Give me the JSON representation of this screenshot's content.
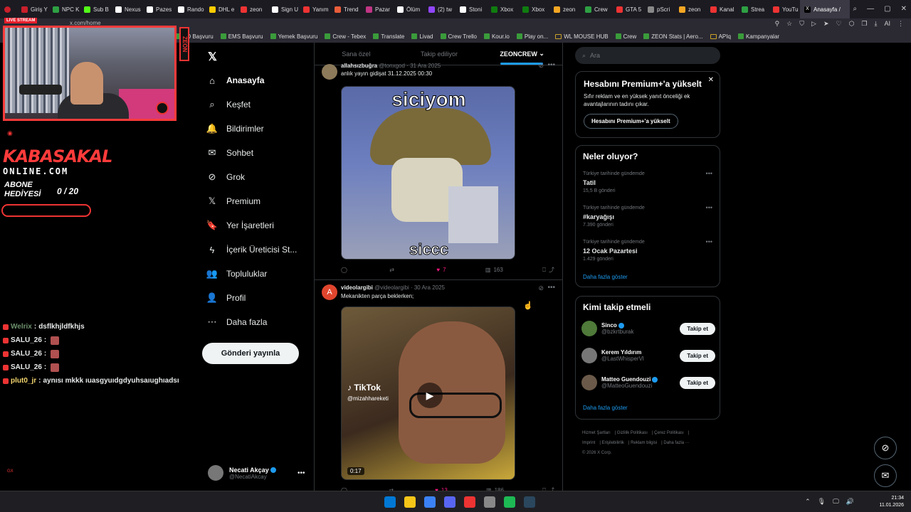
{
  "browser": {
    "tabs": [
      {
        "label": "Giriş Y",
        "color": "#c8202b"
      },
      {
        "label": "NPC K",
        "color": "#2ea043"
      },
      {
        "label": "Sub B",
        "color": "#53fc18"
      },
      {
        "label": "Nexus",
        "color": "#ffffff"
      },
      {
        "label": "Pazes",
        "color": "#ffffff"
      },
      {
        "label": "Rando",
        "color": "#ffffff"
      },
      {
        "label": "DHL e",
        "color": "#ffcc00"
      },
      {
        "label": "zeon",
        "color": "#e33"
      },
      {
        "label": "Sign U",
        "color": "#ffffff"
      },
      {
        "label": "Yanım",
        "color": "#e33"
      },
      {
        "label": "Trend",
        "color": "#e85d3a"
      },
      {
        "label": "Pazar",
        "color": "#c13584"
      },
      {
        "label": "Ölüm",
        "color": "#ffffff"
      },
      {
        "label": "(2) tw",
        "color": "#9146ff"
      },
      {
        "label": "Stoni",
        "color": "#ffffff"
      },
      {
        "label": "Xbox",
        "color": "#107c10"
      },
      {
        "label": "Xbox",
        "color": "#107c10"
      },
      {
        "label": "zeon",
        "color": "#f5a623"
      },
      {
        "label": "Crew",
        "color": "#2ea043"
      },
      {
        "label": "GTA 5",
        "color": "#e33"
      },
      {
        "label": "pScri",
        "color": "#888888"
      },
      {
        "label": "zeon",
        "color": "#f5a623"
      },
      {
        "label": "Kanal",
        "color": "#e33"
      },
      {
        "label": "Strea",
        "color": "#2ea043"
      },
      {
        "label": "YouTu",
        "color": "#e33"
      }
    ],
    "active_tab": "Anasayfa /",
    "url": "x.com/home",
    "bookmarks": [
      {
        "label": "PD Başvuru",
        "folder": false
      },
      {
        "label": "EMS Başvuru",
        "folder": false
      },
      {
        "label": "Yemek Başvuru",
        "folder": false
      },
      {
        "label": "Crew - Tebex",
        "folder": false
      },
      {
        "label": "Translate",
        "folder": false
      },
      {
        "label": "Livad",
        "folder": false
      },
      {
        "label": "Crew Trello",
        "folder": false
      },
      {
        "label": "Kour.io",
        "folder": false
      },
      {
        "label": "Play on...",
        "folder": false
      },
      {
        "label": "WL MOUSE HUB",
        "folder": true
      },
      {
        "label": "Crew",
        "folder": false
      },
      {
        "label": "ZEON Stats | Aero...",
        "folder": false
      },
      {
        "label": "APIq",
        "folder": true
      },
      {
        "label": "Kampanyalar",
        "folder": false
      }
    ],
    "extra_label": "AI"
  },
  "stream_overlay": {
    "live_label": "LIVE STREAM",
    "vertical_brand": "ZEON",
    "brand_line1": "KABASAKAL",
    "brand_line2": "ONLINE.COM",
    "sub_label": "ABONE HEDİYESİ",
    "sub_count": "0 / 20",
    "chat": [
      {
        "user": "Welrix",
        "msg": "dsflkhjldfkhjs",
        "color": "#6b8f6b",
        "emote": false
      },
      {
        "user": "SALU_26",
        "msg": "",
        "color": "#e7e9ea",
        "emote": true
      },
      {
        "user": "SALU_26",
        "msg": "",
        "color": "#e7e9ea",
        "emote": true
      },
      {
        "user": "SALU_26",
        "msg": "",
        "color": "#e7e9ea",
        "emote": true
      },
      {
        "user": "plut0_jr",
        "msg": "aynısı mkkk ıuasgyuıdgdyuhsaıughıadsı",
        "color": "#f5d76e",
        "emote": false
      }
    ]
  },
  "nav": {
    "items": [
      {
        "label": "Anasayfa",
        "icon": "home-icon",
        "glyph": "⌂",
        "active": true
      },
      {
        "label": "Keşfet",
        "icon": "search-icon",
        "glyph": "⌕",
        "active": false
      },
      {
        "label": "Bildirimler",
        "icon": "bell-icon",
        "glyph": "🔔",
        "active": false
      },
      {
        "label": "Sohbet",
        "icon": "mail-icon",
        "glyph": "✉",
        "active": false
      },
      {
        "label": "Grok",
        "icon": "grok-icon",
        "glyph": "⊘",
        "active": false
      },
      {
        "label": "Premium",
        "icon": "x-premium-icon",
        "glyph": "𝕏",
        "active": false
      },
      {
        "label": "Yer İşaretleri",
        "icon": "bookmark-icon",
        "glyph": "🔖",
        "active": false
      },
      {
        "label": "İçerik Üreticisi St...",
        "icon": "lightning-icon",
        "glyph": "ϟ",
        "active": false
      },
      {
        "label": "Topluluklar",
        "icon": "communities-icon",
        "glyph": "👥",
        "active": false
      },
      {
        "label": "Profil",
        "icon": "profile-icon",
        "glyph": "👤",
        "active": false
      },
      {
        "label": "Daha fazla",
        "icon": "more-circle-icon",
        "glyph": "⋯",
        "active": false
      }
    ],
    "post_button": "Gönderi yayınla",
    "profile_name": "Necati Akçay",
    "profile_handle": "@NecatiAkcay"
  },
  "feed": {
    "tabs": [
      "Sana özel",
      "Takip ediliyor",
      "ZEONCREW"
    ],
    "active_tab": "ZEONCREW",
    "tweets": [
      {
        "name": "allahsızbuğra",
        "handle": "@tonxgod",
        "date": "31 Ara 2025",
        "text": "anlık yayın gidişat 31.12.2025 00:30",
        "media_caption_top": "siciyom",
        "media_caption_bottom": "siccc",
        "replies": "",
        "retweets": "",
        "likes": "7",
        "views": "163"
      },
      {
        "name": "videolargibi",
        "handle": "@videolargibi",
        "date": "30 Ara 2025",
        "text": "Mekanikten parça beklerken;",
        "media_watermark": "TikTok",
        "media_handle": "@mizahhareketi",
        "duration": "0:17",
        "replies": "",
        "retweets": "",
        "likes": "13",
        "views": "186"
      }
    ]
  },
  "sidebar": {
    "search_placeholder": "Ara",
    "premium": {
      "title": "Hesabını Premium+'a yükselt",
      "desc": "Sıfır reklam ve en yüksek yanıt önceliği ek avantajlarının tadını çıkar.",
      "button": "Hesabını Premium+'a yükselt"
    },
    "trends_title": "Neler oluyor?",
    "trends": [
      {
        "context": "Türkiye tarihinde gündemde",
        "name": "Tatil",
        "count": "15,5 B gönderi"
      },
      {
        "context": "Türkiye tarihinde gündemde",
        "name": "#karyağışı",
        "count": "7.390 gönderi"
      },
      {
        "context": "Türkiye tarihinde gündemde",
        "name": "12 Ocak Pazartesi",
        "count": "1.429 gönderi"
      }
    ],
    "show_more": "Daha fazla göster",
    "who_title": "Kimi takip etmeli",
    "who": [
      {
        "name": "Sinco",
        "handle": "@bzkrtburak",
        "verified": true
      },
      {
        "name": "Kerem Yıldırım",
        "handle": "@LastWhisperVl",
        "verified": false
      },
      {
        "name": "Matteo Guendouzi",
        "handle": "@MatteoGuendouzi",
        "verified": true
      }
    ],
    "follow_label": "Takip et",
    "who_show_more": "Daha fazla göster",
    "footer": [
      "Hizmet Şartları",
      "Gizlilik Politikası",
      "Çerez Politikası",
      "Imprint",
      "Erişilebilirlik",
      "Reklam bilgisi",
      "Daha fazla ···",
      "© 2026 X Corp."
    ]
  },
  "taskbar": {
    "icon_colors": [
      "#0078d4",
      "#f5c518",
      "#3b82f6",
      "#5865f2",
      "#e33",
      "#888888",
      "#1db954",
      "#2a475e"
    ],
    "time": "21:34",
    "date": "11.01.2026"
  }
}
